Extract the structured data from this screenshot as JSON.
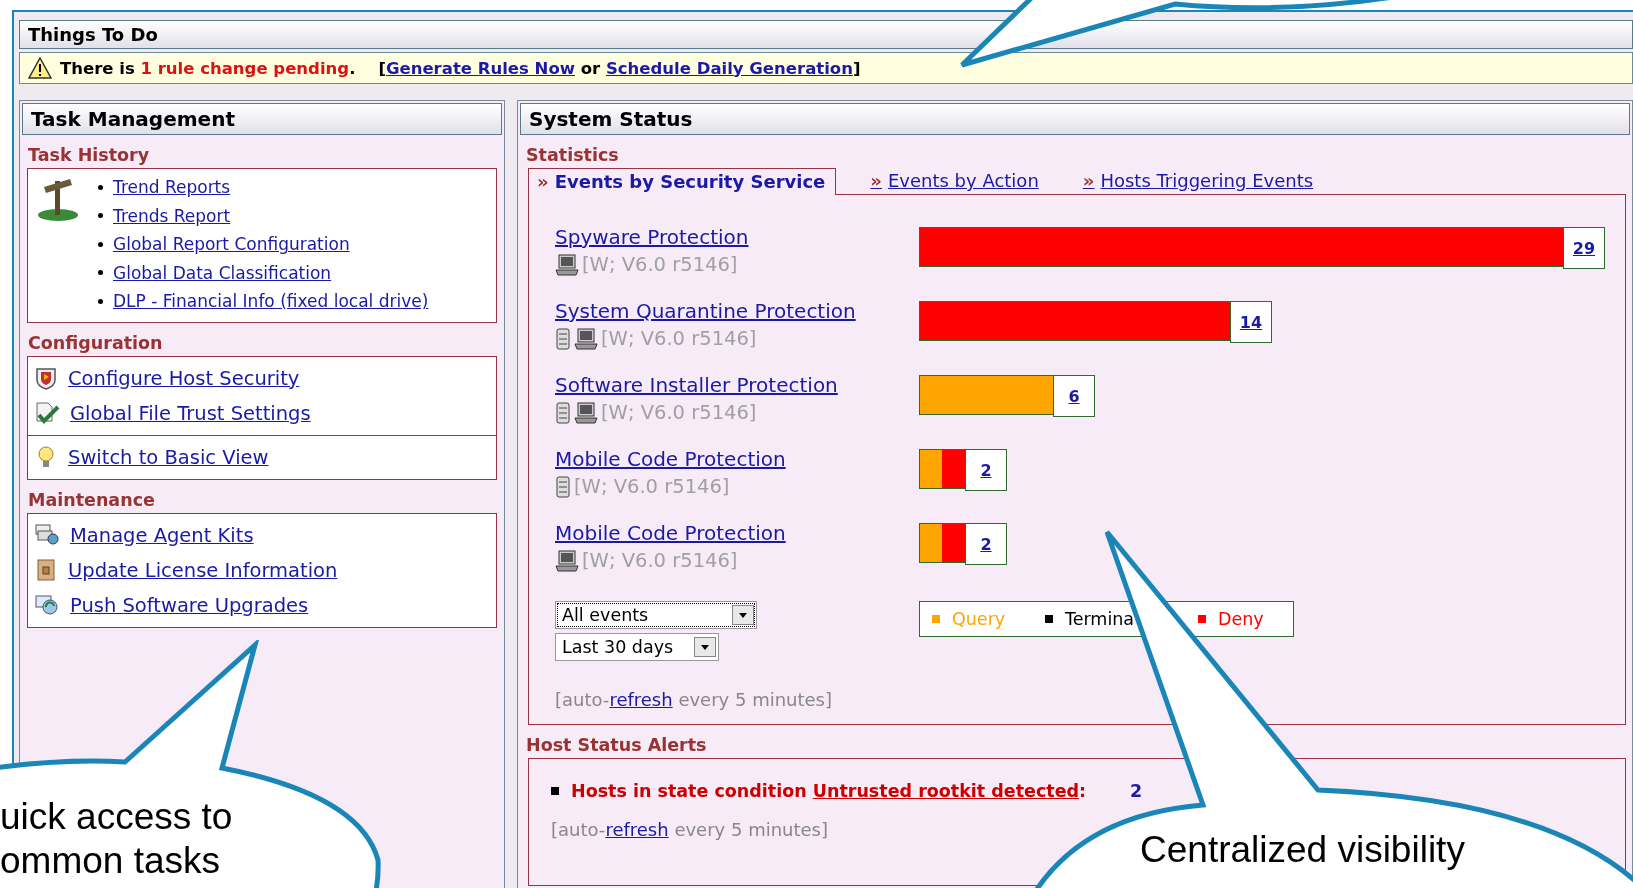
{
  "things_to_do": {
    "title": "Things To Do",
    "message": [
      {
        "kind": "plain",
        "text": "There is "
      },
      {
        "kind": "alert",
        "text": "1 rule change pending"
      },
      {
        "kind": "plain",
        "text": ".    ["
      },
      {
        "kind": "link",
        "text": "Generate Rules Now"
      },
      {
        "kind": "plain",
        "text": " or "
      },
      {
        "kind": "link",
        "text": "Schedule Daily Generation"
      },
      {
        "kind": "plain",
        "text": "]"
      }
    ]
  },
  "task_management": {
    "title": "Task Management",
    "sections": [
      {
        "title": "Task History",
        "kind": "bullets",
        "groups": [
          {
            "items": [
              {
                "label": "Trend Reports"
              },
              {
                "label": "Trends Report"
              },
              {
                "label": "Global Report Configuration"
              },
              {
                "label": "Global Data Classification"
              },
              {
                "label": "DLP - Financial Info (fixed local drive)"
              }
            ]
          }
        ]
      },
      {
        "title": "Configuration",
        "kind": "icons",
        "groups": [
          {
            "items": [
              {
                "label": "Configure Host Security",
                "kind": "shield"
              },
              {
                "label": "Global File Trust Settings",
                "kind": "file-check"
              }
            ]
          },
          {
            "items": [
              {
                "label": "Switch to Basic View",
                "kind": "bulb"
              }
            ]
          }
        ]
      },
      {
        "title": "Maintenance",
        "kind": "icons",
        "groups": [
          {
            "items": [
              {
                "label": "Manage Agent Kits",
                "kind": "kit"
              },
              {
                "label": "Update License Information",
                "kind": "license"
              },
              {
                "label": "Push Software Upgrades",
                "kind": "upgrade"
              }
            ]
          }
        ]
      }
    ]
  },
  "system_status": {
    "title": "System Status",
    "statistics": {
      "title": "Statistics",
      "tabs": [
        {
          "marker": "»",
          "label": "Events by Security Service",
          "selected": true
        },
        {
          "marker": "»",
          "label": "Events by Action",
          "selected": false
        },
        {
          "marker": "»",
          "label": "Hosts Triggering Events",
          "selected": false
        }
      ],
      "services": [
        {
          "name": "Spyware Protection",
          "hosts": [
            {
              "kind": "desktop"
            }
          ],
          "version": "[W; V6.0 r5146]",
          "count": "29",
          "segments": [
            {
              "color": "#ff0000"
            }
          ]
        },
        {
          "name": "System Quarantine Protection",
          "hosts": [
            {
              "kind": "server"
            },
            {
              "kind": "desktop"
            }
          ],
          "version": "[W; V6.0 r5146]",
          "count": "14",
          "segments": [
            {
              "color": "#ff0000"
            }
          ]
        },
        {
          "name": "Software Installer Protection",
          "hosts": [
            {
              "kind": "server"
            },
            {
              "kind": "desktop"
            }
          ],
          "version": "[W; V6.0 r5146]",
          "count": "6",
          "segments": [
            {
              "color": "#ffa500"
            }
          ]
        },
        {
          "name": "Mobile Code Protection",
          "hosts": [
            {
              "kind": "server"
            }
          ],
          "version": "[W; V6.0 r5146]",
          "count": "2",
          "segments": [
            {
              "color": "#ffa500"
            },
            {
              "color": "#ff0000"
            }
          ]
        },
        {
          "name": "Mobile Code Protection",
          "hosts": [
            {
              "kind": "desktop"
            }
          ],
          "version": "[W; V6.0 r5146]",
          "count": "2",
          "segments": [
            {
              "color": "#ffa500"
            },
            {
              "color": "#ff0000"
            }
          ]
        }
      ],
      "filters": [
        {
          "value": "All events",
          "focused": true
        },
        {
          "value": "Last 30 days",
          "focused": false
        }
      ],
      "legend": [
        {
          "label": "Query",
          "color": "#ffa500"
        },
        {
          "label": "Termina",
          "color": "#000000"
        },
        {
          "label": "Deny",
          "color": "#ff0000"
        }
      ],
      "refresh": [
        {
          "kind": "plain",
          "text": "[auto-"
        },
        {
          "kind": "link",
          "text": "refresh"
        },
        {
          "kind": "plain",
          "text": " every 5 minutes]"
        }
      ]
    },
    "alerts": {
      "title": "Host Status Alerts",
      "items": [
        {
          "text": "Hosts in state condition ",
          "link": "Untrusted rootkit detected",
          "suffix": ":",
          "count": "2"
        }
      ],
      "refresh": [
        {
          "kind": "plain",
          "text": "[auto-"
        },
        {
          "kind": "link",
          "text": "refresh"
        },
        {
          "kind": "plain",
          "text": " every 5 minutes]"
        }
      ]
    }
  },
  "callouts": [
    {
      "lines": [
        "uick access to",
        "ommon tasks"
      ]
    },
    {
      "lines": [
        "Centralized visibility"
      ]
    }
  ]
}
